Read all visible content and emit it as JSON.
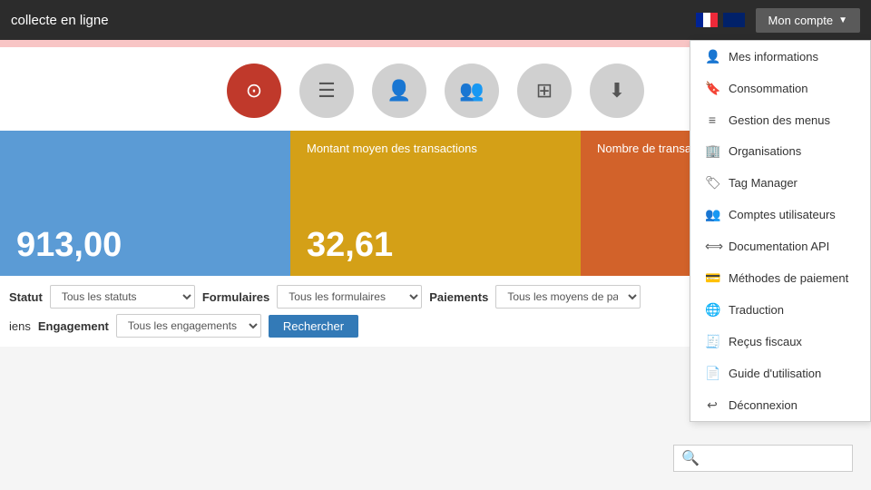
{
  "topnav": {
    "title": "collecte en ligne",
    "mon_compte_label": "Mon compte"
  },
  "icons": [
    {
      "name": "dashboard-icon",
      "symbol": "⊙",
      "active": true
    },
    {
      "name": "menu-icon",
      "symbol": "☰",
      "active": false
    },
    {
      "name": "user-icon",
      "symbol": "👤",
      "active": false
    },
    {
      "name": "users-icon",
      "symbol": "👥",
      "active": false
    },
    {
      "name": "grid-icon",
      "symbol": "⊞",
      "active": false
    },
    {
      "name": "download-icon",
      "symbol": "⬇",
      "active": false
    }
  ],
  "stats": [
    {
      "label": "",
      "value": "913,00",
      "color": "blue"
    },
    {
      "label": "Montant moyen des transactions",
      "value": "32,61",
      "color": "gold"
    },
    {
      "label": "Nombre de transaction",
      "value": "",
      "color": "orange"
    }
  ],
  "filters": {
    "statut_label": "Statut",
    "statut_placeholder": "Tous les statuts",
    "formulaires_label": "Formulaires",
    "formulaires_placeholder": "Tous les formulaires",
    "paiements_label": "Paiements",
    "paiements_placeholder": "Tous les moyens de paiement",
    "engagement_label": "Engagement",
    "engagement_placeholder": "Tous les engagements",
    "search_label": "Rechercher"
  },
  "dropdown": {
    "items": [
      {
        "icon": "👤",
        "label": "Mes informations",
        "name": "mes-informations"
      },
      {
        "icon": "🔖",
        "label": "Consommation",
        "name": "consommation"
      },
      {
        "icon": "≡",
        "label": "Gestion des menus",
        "name": "gestion-menus"
      },
      {
        "icon": "🏢",
        "label": "Organisations",
        "name": "organisations"
      },
      {
        "icon": "🏷",
        "label": "Tag Manager",
        "name": "tag-manager"
      },
      {
        "icon": "👥",
        "label": "Comptes utilisateurs",
        "name": "comptes-utilisateurs"
      },
      {
        "icon": "⟺",
        "label": "Documentation API",
        "name": "documentation-api"
      },
      {
        "icon": "💳",
        "label": "Méthodes de paiement",
        "name": "methodes-paiement"
      },
      {
        "icon": "🌐",
        "label": "Traduction",
        "name": "traduction"
      },
      {
        "icon": "🧾",
        "label": "Reçus fiscaux",
        "name": "recus-fiscaux"
      },
      {
        "icon": "📄",
        "label": "Guide d'utilisation",
        "name": "guide-utilisation"
      },
      {
        "icon": "↩",
        "label": "Déconnexion",
        "name": "deconnexion"
      }
    ]
  },
  "bottom_search": {
    "placeholder": ""
  }
}
